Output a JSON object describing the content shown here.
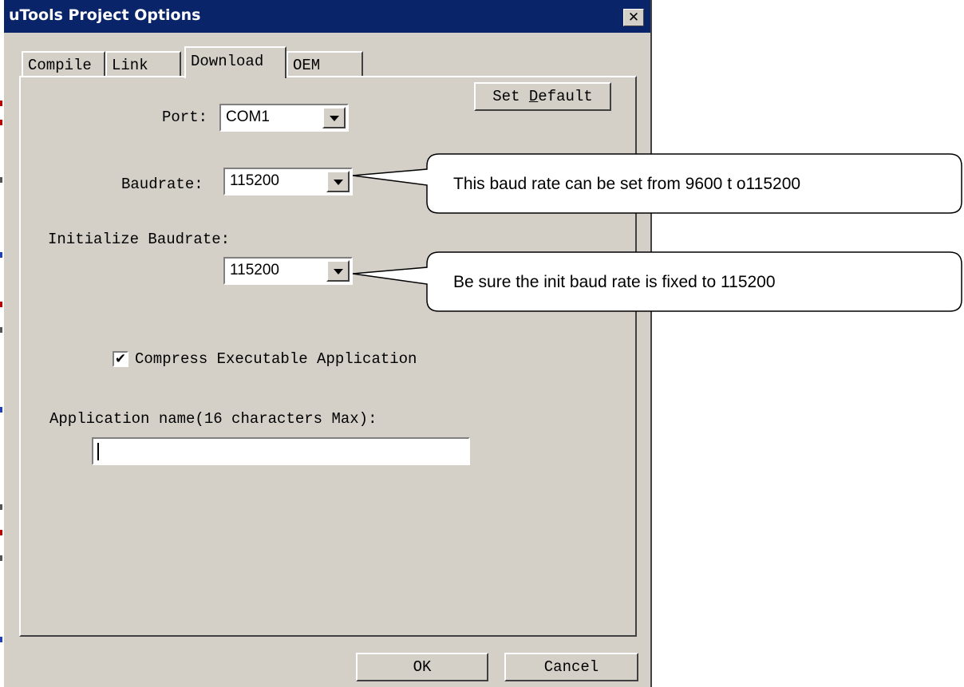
{
  "window": {
    "title": "uTools Project Options",
    "close_glyph": "✕"
  },
  "tabs": [
    {
      "label": "Compile",
      "active": false
    },
    {
      "label": "Link",
      "active": false
    },
    {
      "label": "Download",
      "active": true
    },
    {
      "label": "OEM",
      "active": false
    }
  ],
  "download": {
    "set_default_prefix": "Set ",
    "set_default_accel": "D",
    "set_default_suffix": "efault",
    "port_label": "Port:",
    "port_value": "COM1",
    "baudrate_label": "Baudrate:",
    "baudrate_value": "115200",
    "init_baudrate_label": "Initialize Baudrate:",
    "init_baudrate_value": "115200",
    "compress_label": "Compress Executable Application",
    "compress_checked": true,
    "check_glyph": "✔",
    "app_name_label": "Application name(16 characters Max):",
    "app_name_value": ""
  },
  "footer": {
    "ok_label": "OK",
    "cancel_label": "Cancel"
  },
  "callouts": {
    "baud_note": "This baud rate can be set from 9600 t o115200",
    "init_note": "Be sure the init baud rate is fixed to 115200"
  },
  "colors": {
    "title_bar": "#0a246a",
    "dialog_face": "#d4d0c8",
    "edge_red": "#c00000",
    "edge_blue": "#1f3fbf"
  }
}
